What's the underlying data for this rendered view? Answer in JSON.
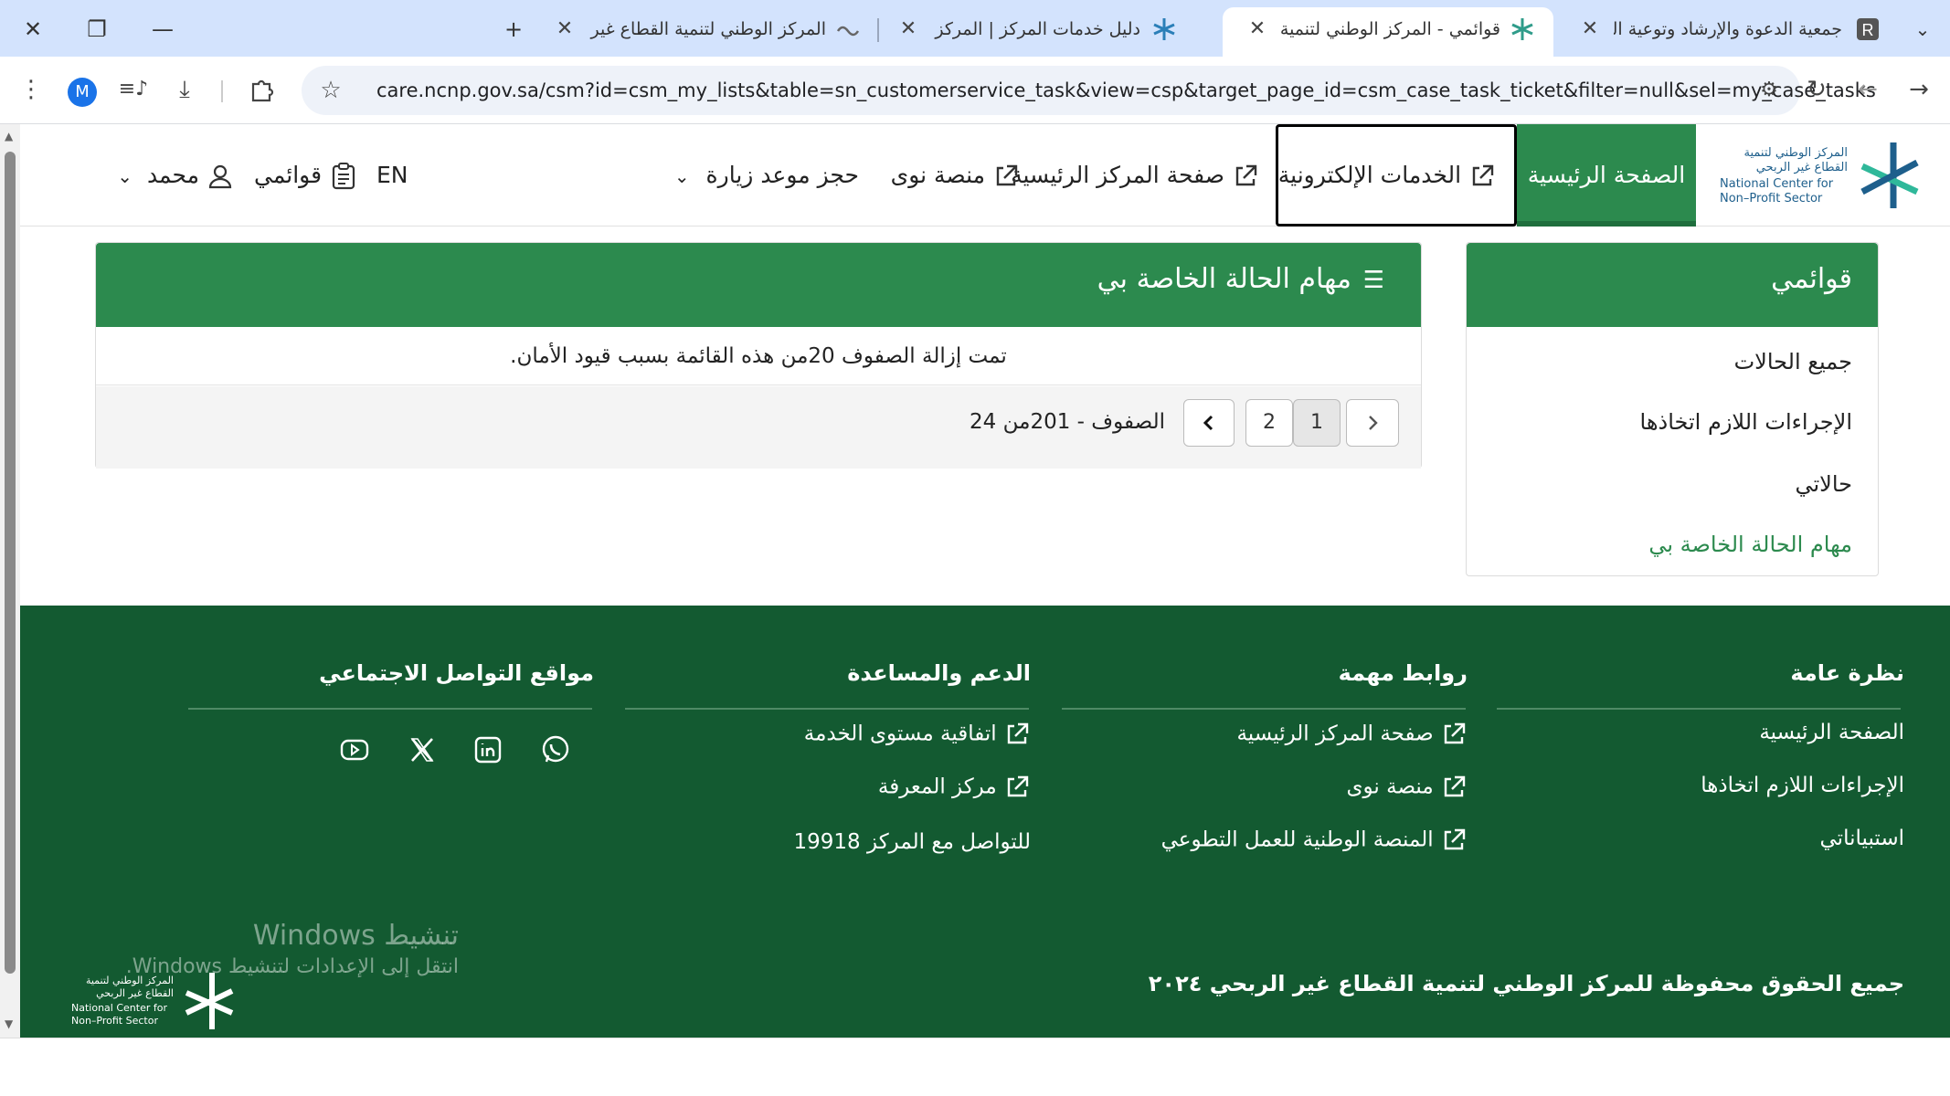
{
  "browser": {
    "tabs": [
      {
        "title": "جمعية الدعوة والإرشاد وتوعية الجا",
        "favicon": "r-logo-icon",
        "active": false
      },
      {
        "title": "قوائمي - المركز الوطني لتنمية الق",
        "favicon": "ncnp-star-icon",
        "active": true
      },
      {
        "title": "دليل خدمات المركز | المركز الوطن",
        "favicon": "ncnp-star-icon",
        "active": false
      },
      {
        "title": "المركز الوطني لتنمية القطاع غير ا",
        "favicon": "ncnp-logo-icon",
        "active": false
      }
    ],
    "new_tab": "+",
    "url": "care.ncnp.gov.sa/csm?id=csm_my_lists&table=sn_customerservice_task&view=csp&target_page_id=csm_case_task_ticket&filter=null&sel=my_case_tasks",
    "profile_initial": "M"
  },
  "header": {
    "logo_text": [
      "المركز الوطني لتنمية",
      "القطاع غير الربحي",
      "National Center for",
      "Non–Profit Sector"
    ],
    "nav": {
      "home": "الصفحة الرئيسية",
      "eservices": "الخدمات الإلكترونية",
      "center_home": "صفحة المركز الرئيسية",
      "nawa": "منصة نوى",
      "visit": "حجز موعد زيارة",
      "lang": "EN",
      "my_lists": "قوائمي",
      "user": "محمد"
    }
  },
  "sidebar": {
    "title": "قوائمي",
    "items": [
      "جميع الحالات",
      "الإجراءات اللازم اتخاذها",
      "حالاتي",
      "مهام الحالة الخاصة بي"
    ],
    "active_index": 3
  },
  "main": {
    "title": "مهام الحالة الخاصة بي",
    "notice": "تمت إزالة الصفوف 20من هذه القائمة بسبب قيود الأمان.",
    "rows_label": "الصفوف - 201من 24",
    "pages": [
      "1",
      "2"
    ],
    "current_page": "1"
  },
  "footer": {
    "columns": [
      {
        "title": "نظرة عامة",
        "links": [
          "الصفحة الرئيسية",
          "الإجراءات اللازم اتخاذها",
          "استبياناتي"
        ]
      },
      {
        "title": "روابط مهمة",
        "links": [
          "صفحة المركز الرئيسية",
          "منصة نوى",
          "المنصة الوطنية للعمل التطوعي"
        ]
      },
      {
        "title": "الدعم والمساعدة",
        "links": [
          "اتفاقية مستوى الخدمة",
          "مركز المعرفة",
          "للتواصل مع المركز 19918"
        ]
      },
      {
        "title": "مواقع التواصل الاجتماعي",
        "icons": [
          "whatsapp-icon",
          "linkedin-icon",
          "x-icon",
          "youtube-icon"
        ]
      }
    ],
    "copyright": "جميع الحقوق محفوظة للمركز الوطني لتنمية القطاع غير الربحي ٢٠٢٤",
    "logo_text": [
      "المركز الوطني لتنمية",
      "القطاع غير الربحي",
      "National Center for",
      "Non–Profit Sector"
    ]
  },
  "watermark": {
    "line1": "تنشيط Windows",
    "line2": "انتقل إلى الإعدادات لتنشيط Windows."
  },
  "colors": {
    "brand_green": "#2c8a4e",
    "footer_green": "#135a31",
    "tab_bar": "#d3e3fd"
  }
}
